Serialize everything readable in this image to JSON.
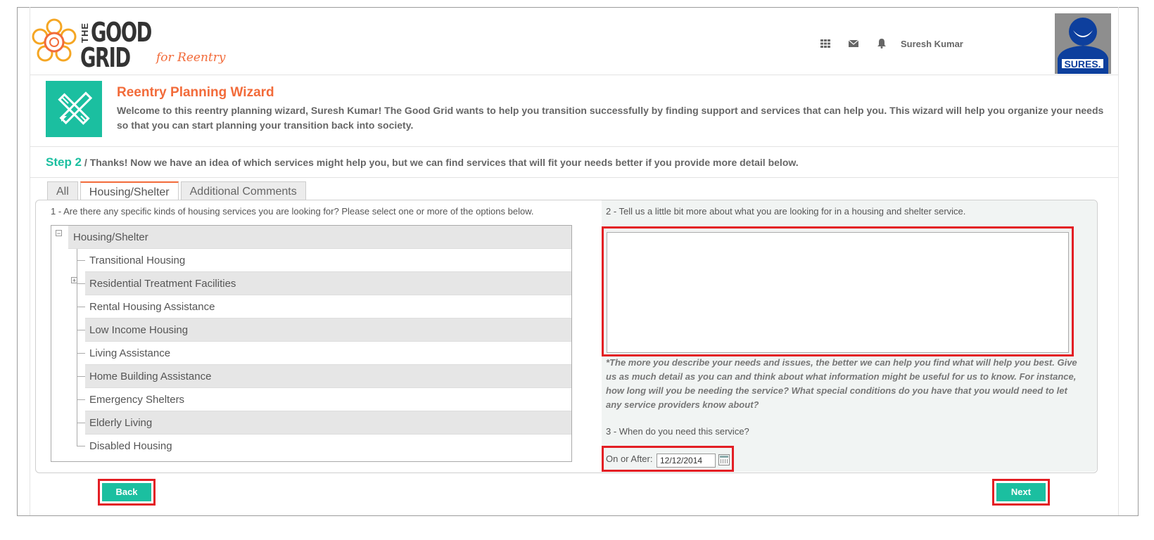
{
  "logo": {
    "the": "THE",
    "good": "GOOD",
    "grid": "GRID",
    "tagline": "for Reentry"
  },
  "header": {
    "icons": [
      "apps-grid-icon",
      "mail-icon",
      "bell-icon"
    ],
    "user_name": "Suresh Kumar",
    "avatar_label": "SURES."
  },
  "wizard": {
    "title": "Reentry Planning Wizard",
    "description": "Welcome to this reentry planning wizard, Suresh Kumar! The Good Grid wants to help you transition successfully by finding support and services that can help you. This wizard will help you organize your needs so that you can start planning your transition back into society."
  },
  "step": {
    "number": "Step 2",
    "text": " / Thanks! Now we have an idea of which services might help you, but we can find services that will fit your needs better if you provide more detail below."
  },
  "tabs": [
    {
      "label": "All"
    },
    {
      "label": "Housing/Shelter",
      "active": true
    },
    {
      "label": "Additional Comments"
    }
  ],
  "question1": "1 - Are there any specific kinds of housing services you are looking for? Please select one or more of the options below.",
  "tree": {
    "root": "Housing/Shelter",
    "items": [
      "Transitional Housing",
      "Residential Treatment Facilities",
      "Rental Housing Assistance",
      "Low Income Housing",
      "Living Assistance",
      "Home Building Assistance",
      "Emergency Shelters",
      "Elderly Living",
      "Disabled Housing"
    ]
  },
  "question2": "2 - Tell us a little bit more about what you are looking for in a housing and shelter service.",
  "details_value": "",
  "hint": "*The more you describe your needs and issues, the better we can help you find what will help you best. Give us as much detail as you can and think about what information might be useful for us to know. For instance, how long will you be needing the service? What special conditions do you have that you would need to let any service providers know about?",
  "question3": "3 - When do you need this service?",
  "date": {
    "label": "On or After:",
    "value": "12/12/2014"
  },
  "buttons": {
    "back": "Back",
    "next": "Next"
  },
  "colors": {
    "accent": "#1bbfa0",
    "brand_orange": "#f26b3a",
    "highlight": "#e31e24"
  }
}
